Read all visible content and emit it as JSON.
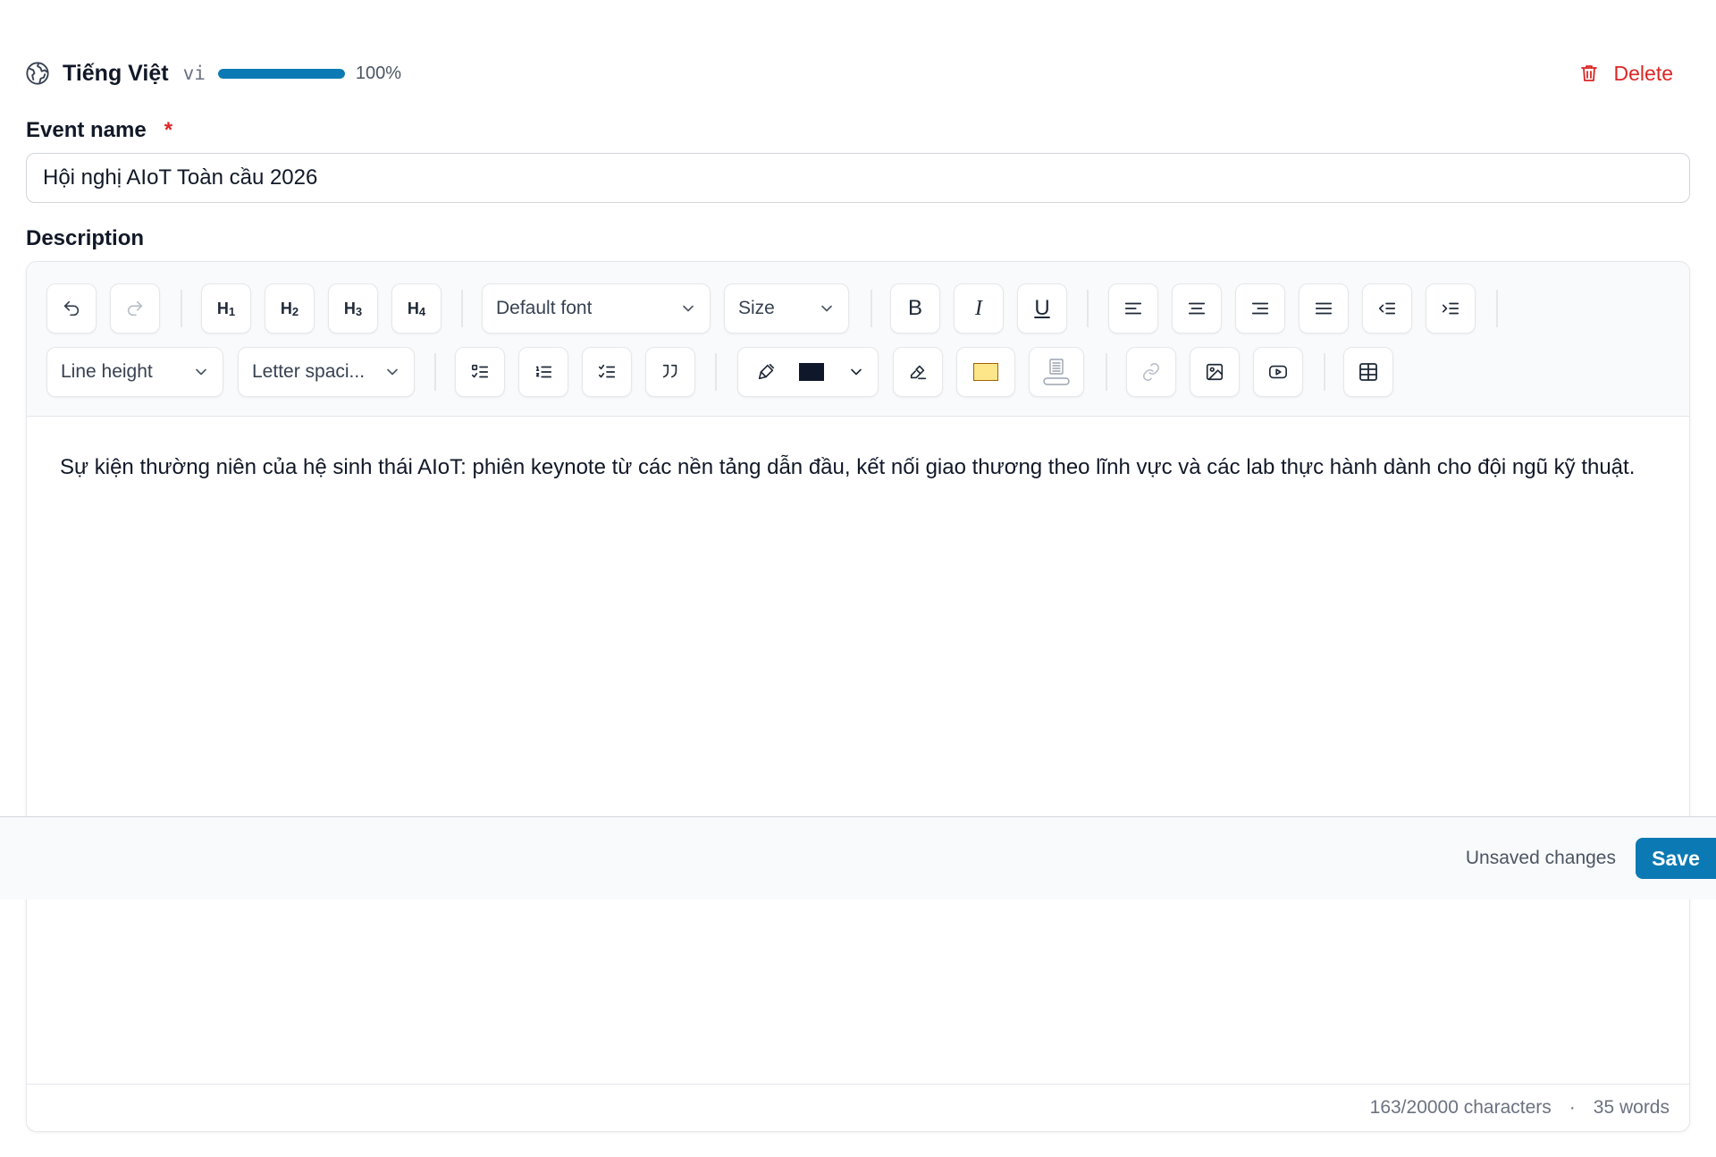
{
  "language": {
    "name": "Tiếng Việt",
    "code": "vi",
    "progress": 100,
    "progress_label": "100%",
    "icon": "globe-icon"
  },
  "delete_label": "Delete",
  "fields": {
    "event_name_label": "Event name",
    "required_marker": "*",
    "event_name_value": "Hội nghị AIoT Toàn cầu 2026",
    "description_label": "Description"
  },
  "toolbar": {
    "undo": "undo-icon",
    "redo": "redo-icon",
    "headings": [
      "H",
      "H",
      "H",
      "H"
    ],
    "heading_levels": [
      "1",
      "2",
      "3",
      "4"
    ],
    "font_select": "Default font",
    "size_select": "Size",
    "bold": "B",
    "italic": "I",
    "underline": "U",
    "line_height_select": "Line height",
    "letter_spacing_select": "Letter spaci..."
  },
  "colors": {
    "text_color": "#0f172a",
    "highlight_color": "#fde68a",
    "accent": "#0b79b3",
    "danger": "#dc2626"
  },
  "description_text": "Sự kiện thường niên của hệ sinh thái AIoT: phiên keynote từ các nền tảng dẫn đầu, kết nối giao thương theo lĩnh vực và các lab thực hành dành cho đội ngũ kỹ thuật.",
  "footer": {
    "characters": "163/20000 characters",
    "separator": "·",
    "words": "35 words"
  },
  "save_bar": {
    "status": "Unsaved changes",
    "save_label": "Save"
  }
}
